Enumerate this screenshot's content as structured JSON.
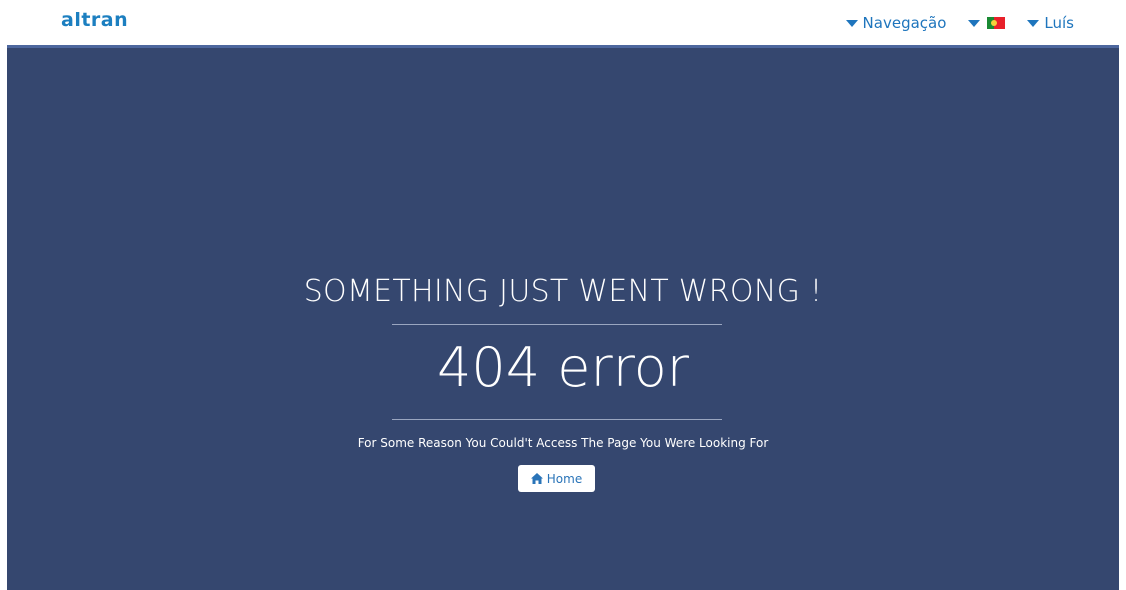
{
  "header": {
    "logo_text": "altran",
    "nav_label": "Navegação",
    "language_flag": "portugal-flag",
    "user_label": "Luís"
  },
  "error": {
    "headline": "SOMETHING JUST WENT WRONG !",
    "code": "404 error",
    "message": "For Some Reason You Could't Access The Page You Were Looking For",
    "home_label": "Home"
  },
  "colors": {
    "background": "#35476f",
    "accent": "#1e75bd",
    "text": "#ffffff"
  }
}
